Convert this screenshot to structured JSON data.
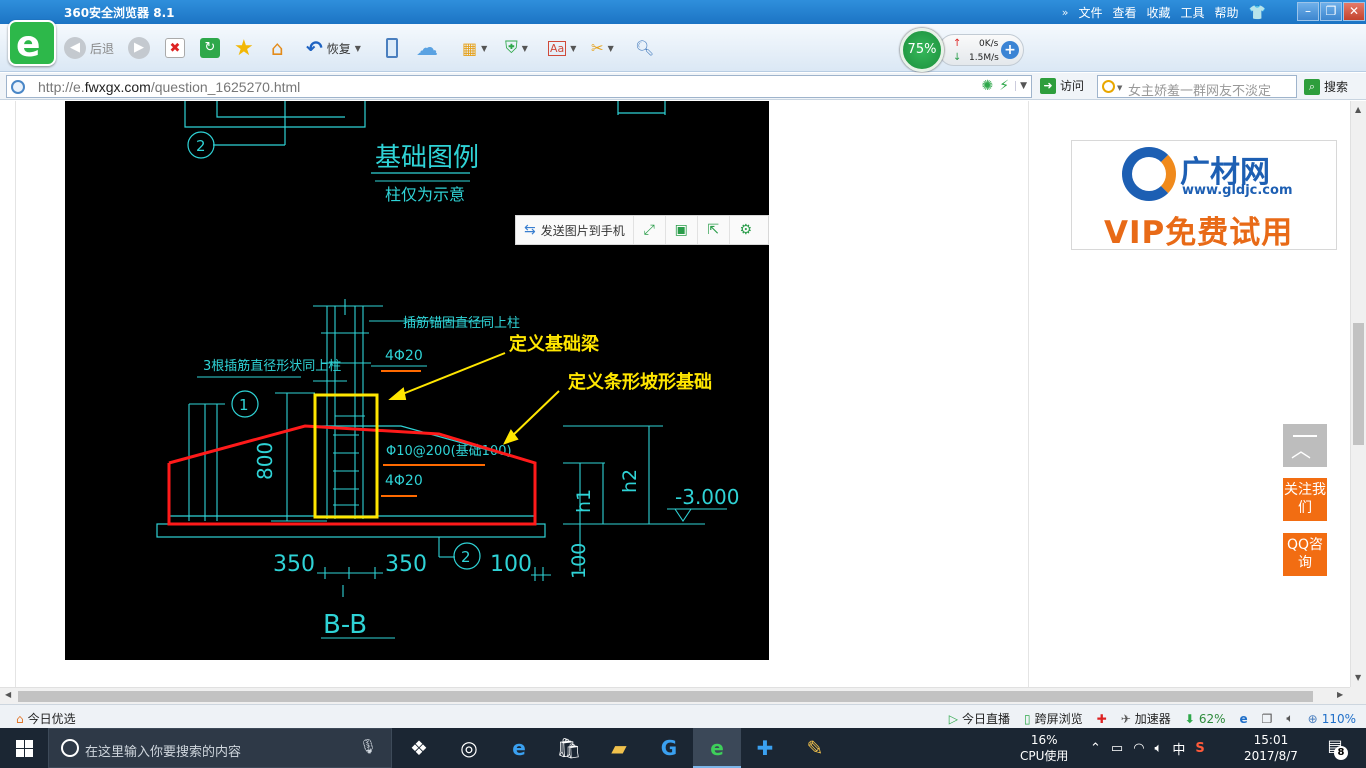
{
  "browser": {
    "title": "360安全浏览器 8.1",
    "menu": [
      "文件",
      "查看",
      "收藏",
      "工具",
      "帮助"
    ],
    "logo_letter": "e",
    "toolbar": {
      "back_label": "后退",
      "restore_label": "恢复"
    },
    "speed": {
      "percent": "75%",
      "up": "0K/s",
      "down": "1.5M/s"
    },
    "address": {
      "protocol": "http://e.",
      "domain": "fwxgx.com",
      "path": "/question_1625270.html"
    },
    "visit_label": "访问",
    "search_placeholder": "女主娇羞一群网友不淡定",
    "search_button": "搜索"
  },
  "page": {
    "image_toolbar": {
      "send_label": "发送图片到手机"
    },
    "cad": {
      "legend_title": "基础图例",
      "legend_sub": "柱仅为示意",
      "note_top": "插筋锚固直径同上柱",
      "note_left": "3根插筋直径形状同上柱",
      "rebar1": "4Φ20",
      "rebar2": "Φ10@200(基础100)",
      "rebar3": "4Φ20",
      "dim_800": "800",
      "dim_350a": "350",
      "dim_350b": "350",
      "dim_100a": "100",
      "dim_100b": "100",
      "h1": "h1",
      "h2": "h2",
      "elev": "-3.000",
      "section": "B-B",
      "circle1": "1",
      "circle2": "2",
      "annot_beam": "定义基础梁",
      "annot_strip": "定义条形坡形基础"
    },
    "ad": {
      "brand": "广材网",
      "site": "www.gldjc.com",
      "slogan": "VIP免费试用"
    },
    "side": {
      "follow": "关注我们",
      "qq": "QQ咨询"
    }
  },
  "statusbar": {
    "left": "今日优选",
    "live": "今日直播",
    "screen": "跨屏浏览",
    "accel": "加速器",
    "download_pct": "62%",
    "zoom": "110%"
  },
  "taskbar": {
    "search_placeholder": "在这里输入你要搜索的内容",
    "cpu_pct": "16%",
    "cpu_label": "CPU使用",
    "ime": "中",
    "time": "15:01",
    "date": "2017/8/7",
    "notif_count": "8"
  },
  "colors": {
    "accent_green": "#2db84a",
    "cad_cyan": "#2fd3d6",
    "annot_yellow": "#ffe600",
    "mark_red": "#ff1a1a",
    "side_orange": "#f26d12"
  }
}
